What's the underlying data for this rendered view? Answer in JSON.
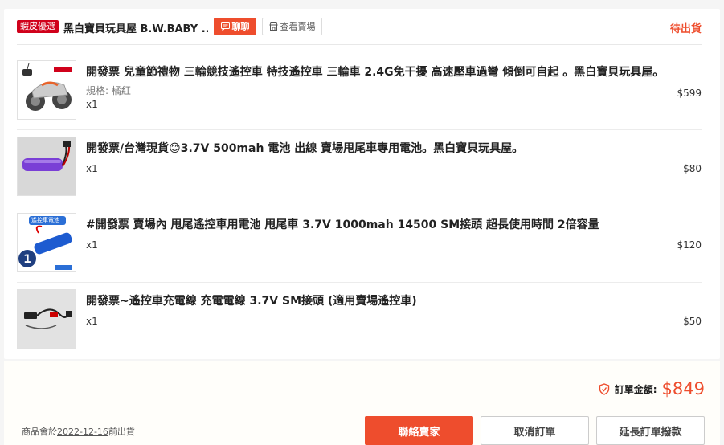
{
  "shop": {
    "badge": "蝦皮優選",
    "name": "黑白寶貝玩具屋 B.W.BABY ...",
    "chat_label": "聊聊",
    "view_shop_label": "查看賣場",
    "status": "待出貨"
  },
  "items": [
    {
      "title": "開發票 兒童節禮物 三輪競技遙控車 特技遙控車 三輪車 2.4G免干擾 高速壓車過彎 傾倒可自起 。黑白寶貝玩具屋。",
      "variant": "規格: 橘紅",
      "qty": "x1",
      "price": "$599"
    },
    {
      "title": "開發票/台灣現貨😊3.7V 500mah 電池 出線 賣場甩尾車專用電池。黑白寶貝玩具屋。",
      "qty": "x1",
      "price": "$80"
    },
    {
      "title": "#開發票 賣場內 甩尾遙控車用電池 甩尾車 3.7V 1000mah 14500 SM接頭 超長使用時間 2倍容量",
      "qty": "x1",
      "price": "$120",
      "thumb_label": "遙控車電池"
    },
    {
      "title": "開發票~遙控車充電線 充電電線 3.7V SM接頭 (適用賣場遙控車)",
      "qty": "x1",
      "price": "$50"
    }
  ],
  "footer": {
    "total_label": "訂單金額:",
    "total_value": "$849",
    "ship_prefix": "商品會於",
    "ship_date": "2022-12-16",
    "ship_suffix": "前出貨",
    "contact_seller": "聯絡賣家",
    "cancel_order": "取消訂單",
    "extend_payment": "延長訂單撥款"
  },
  "colors": {
    "accent": "#ee4d2d",
    "badge": "#d0011b"
  }
}
